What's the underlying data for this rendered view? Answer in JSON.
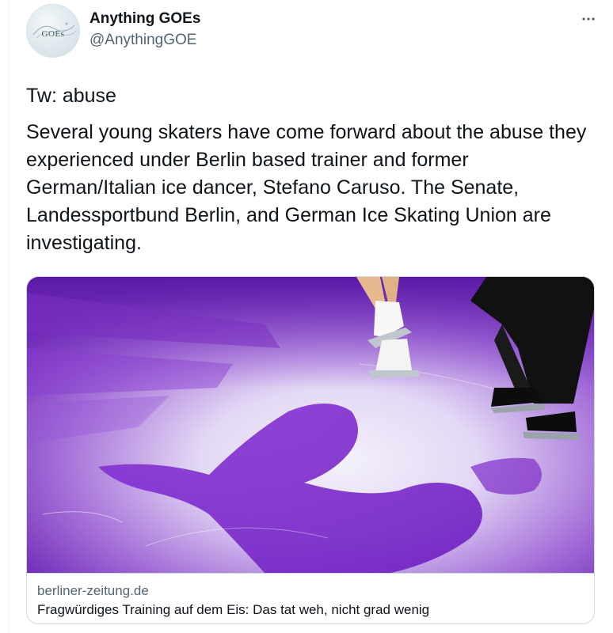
{
  "author": {
    "display_name": "Anything GOEs",
    "handle": "@AnythingGOE",
    "avatar_text": "GOEs"
  },
  "tweet": {
    "warning_line": "Tw: abuse",
    "body": "Several young skaters have come forward about the abuse they experienced under Berlin based trainer and former German/Italian ice dancer, Stefano Caruso. The Senate, Landessportbund Berlin, and German Ice Skating Union are investigating."
  },
  "card": {
    "domain": "berliner-zeitung.de",
    "title": "Fragwürdiges Training auf dem Eis: Das tat weh, nicht grad wenig"
  },
  "icons": {
    "more": "more-horizontal-icon"
  },
  "colors": {
    "text_primary": "#0f1419",
    "text_secondary": "#536471",
    "border": "#cfd9de",
    "image_purple": "#7a2fc0"
  }
}
